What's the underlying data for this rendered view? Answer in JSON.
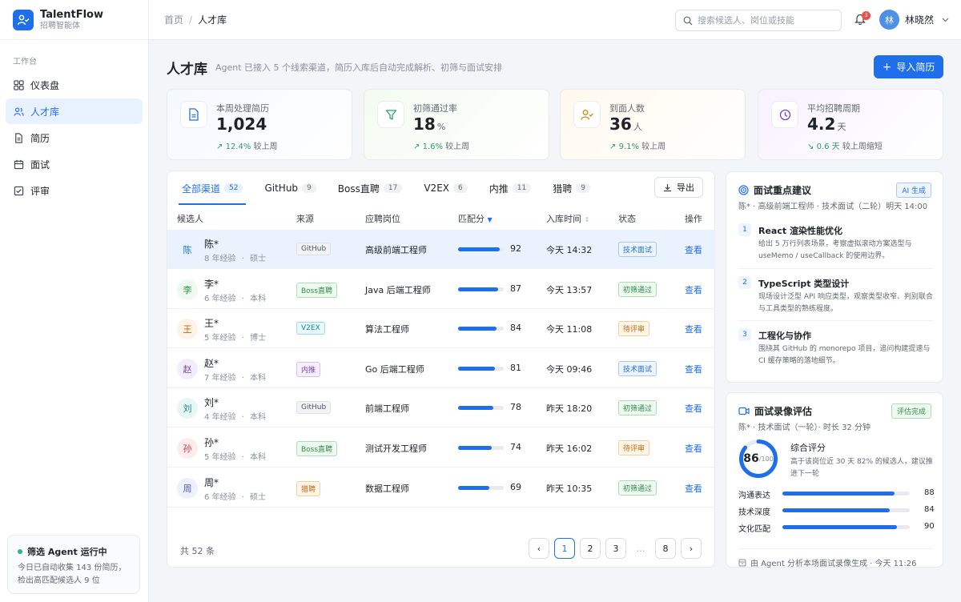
{
  "brand": {
    "name": "TalentFlow",
    "subtitle": "招聘智能体"
  },
  "sidebar": {
    "group_label": "工作台",
    "items": [
      {
        "label": "仪表盘",
        "icon": "dashboard-icon"
      },
      {
        "label": "人才库",
        "icon": "users-icon",
        "active": true
      },
      {
        "label": "简历",
        "icon": "file-icon"
      },
      {
        "label": "面试",
        "icon": "calendar-icon"
      },
      {
        "label": "评审",
        "icon": "check-square-icon"
      }
    ],
    "agent": {
      "title": "筛选 Agent 运行中",
      "desc": "今日已自动收集 143 份简历，检出高匹配候选人 9 位"
    }
  },
  "topbar": {
    "breadcrumb": [
      "首页",
      "/",
      "人才库"
    ],
    "search_placeholder": "搜索候选人、岗位或技能",
    "notifications": "3",
    "user_initial": "林",
    "user_name": "林晓然"
  },
  "page": {
    "title": "人才库",
    "subtitle": "Agent 已接入 5 个线索渠道，简历入库后自动完成解析、初筛与面试安排",
    "import_label": "导入简历"
  },
  "kpis": [
    {
      "label": "本周处理简历",
      "value": "1,024",
      "unit": "",
      "delta": "12.4%",
      "delta_label": "较上周",
      "icon": "document-icon",
      "direction": "up"
    },
    {
      "label": "初筛通过率",
      "value": "18",
      "unit": "%",
      "delta": "1.6%",
      "delta_label": "较上周",
      "icon": "filter-icon",
      "direction": "up"
    },
    {
      "label": "到面人数",
      "value": "36",
      "unit": "人",
      "delta": "9.1%",
      "delta_label": "较上周",
      "icon": "user-check-icon",
      "direction": "up"
    },
    {
      "label": "平均招聘周期",
      "value": "4.2",
      "unit": "天",
      "delta": "0.6 天",
      "delta_label": "较上周缩短",
      "icon": "clock-icon",
      "direction": "down"
    }
  ],
  "tabs": [
    {
      "label": "全部渠道",
      "count": "52",
      "active": true
    },
    {
      "label": "GitHub",
      "count": "9"
    },
    {
      "label": "Boss直聘",
      "count": "17"
    },
    {
      "label": "V2EX",
      "count": "6"
    },
    {
      "label": "内推",
      "count": "11"
    },
    {
      "label": "猎聘",
      "count": "9"
    }
  ],
  "export_label": "导出",
  "columns": [
    "候选人",
    "来源",
    "应聘岗位",
    "匹配分",
    "入库时间",
    "状态",
    "操作"
  ],
  "rows": [
    {
      "initial": "陈",
      "name": "陈*",
      "years": "8",
      "years_label": "年经验",
      "dot": "·",
      "degree": "硕士",
      "source": "GitHub",
      "job": "高级前端工程师",
      "score": 92,
      "time": "今天 14:32",
      "status": "技术面试",
      "action": "查看"
    },
    {
      "initial": "李",
      "name": "李*",
      "years": "6",
      "years_label": "年经验",
      "dot": "·",
      "degree": "本科",
      "source": "Boss直聘",
      "job": "Java 后端工程师",
      "score": 87,
      "time": "今天 13:57",
      "status": "初筛通过",
      "action": "查看"
    },
    {
      "initial": "王",
      "name": "王*",
      "years": "5",
      "years_label": "年经验",
      "dot": "·",
      "degree": "博士",
      "source": "V2EX",
      "job": "算法工程师",
      "score": 84,
      "time": "今天 11:08",
      "status": "待评审",
      "action": "查看"
    },
    {
      "initial": "赵",
      "name": "赵*",
      "years": "7",
      "years_label": "年经验",
      "dot": "·",
      "degree": "本科",
      "source": "内推",
      "job": "Go 后端工程师",
      "score": 81,
      "time": "今天 09:46",
      "status": "技术面试",
      "action": "查看"
    },
    {
      "initial": "刘",
      "name": "刘*",
      "years": "4",
      "years_label": "年经验",
      "dot": "·",
      "degree": "本科",
      "source": "GitHub",
      "job": "前端工程师",
      "score": 78,
      "time": "昨天 18:20",
      "status": "初筛通过",
      "action": "查看"
    },
    {
      "initial": "孙",
      "name": "孙*",
      "years": "5",
      "years_label": "年经验",
      "dot": "·",
      "degree": "本科",
      "source": "Boss直聘",
      "job": "测试开发工程师",
      "score": 74,
      "time": "昨天 16:02",
      "status": "待评审",
      "action": "查看"
    },
    {
      "initial": "周",
      "name": "周*",
      "years": "6",
      "years_label": "年经验",
      "dot": "·",
      "degree": "硕士",
      "source": "猎聘",
      "job": "数据工程师",
      "score": 69,
      "time": "昨天 10:35",
      "status": "初筛通过",
      "action": "查看"
    }
  ],
  "footer": {
    "total": "共 52 条",
    "pages": [
      "1",
      "2",
      "3",
      "…",
      "8"
    ],
    "prev": "‹",
    "next": "›"
  },
  "tips_panel": {
    "title": "面试重点建议",
    "tag": "AI 生成",
    "subtitle": "陈* · 高级前端工程师 · 技术面试（二轮）明天 14:00",
    "tips": [
      {
        "num": "1",
        "title": "React 渲染性能优化",
        "desc": "给出 5 万行列表场景，考察虚拟滚动方案选型与 useMemo / useCallback 的使用边界。"
      },
      {
        "num": "2",
        "title": "TypeScript 类型设计",
        "desc": "现场设计泛型 API 响应类型，观察类型收窄、判别联合与工具类型的熟练程度。"
      },
      {
        "num": "3",
        "title": "工程化与协作",
        "desc": "围绕其 GitHub 的 monorepo 项目，追问构建提速与 CI 缓存策略的落地细节。"
      }
    ]
  },
  "eval_panel": {
    "title": "面试录像评估",
    "tag": "评估完成",
    "subtitle": "陈* · 技术面试（一轮）· 时长 32 分钟",
    "score": 86,
    "score_total": "/100",
    "score_title": "综合评分",
    "score_desc": "高于该岗位近 30 天 82% 的候选人，建议推进下一轮",
    "metrics": [
      {
        "label": "沟通表达",
        "value": 88
      },
      {
        "label": "技术深度",
        "value": 84
      },
      {
        "label": "文化匹配",
        "value": 90
      }
    ],
    "foot": "由 Agent 分析本场面试录像生成 · 今天 11:26"
  }
}
